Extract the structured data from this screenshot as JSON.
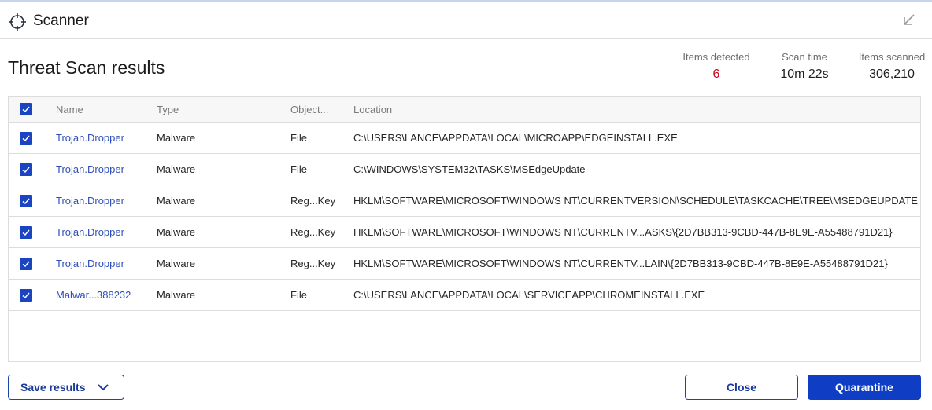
{
  "window": {
    "title": "Scanner",
    "app_icon": "crosshair-icon",
    "minimize_icon": "arrow-down-left-icon"
  },
  "page": {
    "heading": "Threat Scan results"
  },
  "stats": {
    "items_detected_label": "Items detected",
    "items_detected_value": "6",
    "scan_time_label": "Scan time",
    "scan_time_value": "10m 22s",
    "items_scanned_label": "Items scanned",
    "items_scanned_value": "306,210",
    "detected_color": "#d0021b"
  },
  "table": {
    "select_all_checked": true,
    "columns": {
      "name": "Name",
      "type": "Type",
      "object": "Object...",
      "location": "Location"
    },
    "rows": [
      {
        "checked": true,
        "name": "Trojan.Dropper",
        "type": "Malware",
        "object": "File",
        "location": "C:\\USERS\\LANCE\\APPDATA\\LOCAL\\MICROAPP\\EDGEINSTALL.EXE"
      },
      {
        "checked": true,
        "name": "Trojan.Dropper",
        "type": "Malware",
        "object": "File",
        "location": "C:\\WINDOWS\\SYSTEM32\\TASKS\\MSEdgeUpdate"
      },
      {
        "checked": true,
        "name": "Trojan.Dropper",
        "type": "Malware",
        "object": "Reg...Key",
        "location": "HKLM\\SOFTWARE\\MICROSOFT\\WINDOWS NT\\CURRENTVERSION\\SCHEDULE\\TASKCACHE\\TREE\\MSEDGEUPDATE"
      },
      {
        "checked": true,
        "name": "Trojan.Dropper",
        "type": "Malware",
        "object": "Reg...Key",
        "location": "HKLM\\SOFTWARE\\MICROSOFT\\WINDOWS NT\\CURRENTV...ASKS\\{2D7BB313-9CBD-447B-8E9E-A55488791D21}"
      },
      {
        "checked": true,
        "name": "Trojan.Dropper",
        "type": "Malware",
        "object": "Reg...Key",
        "location": "HKLM\\SOFTWARE\\MICROSOFT\\WINDOWS NT\\CURRENTV...LAIN\\{2D7BB313-9CBD-447B-8E9E-A55488791D21}"
      },
      {
        "checked": true,
        "name": "Malwar...388232",
        "type": "Malware",
        "object": "File",
        "location": "C:\\USERS\\LANCE\\APPDATA\\LOCAL\\SERVICEAPP\\CHROMEINSTALL.EXE"
      }
    ]
  },
  "footer": {
    "save_results_label": "Save results",
    "close_label": "Close",
    "quarantine_label": "Quarantine"
  },
  "colors": {
    "accent": "#0f3ec4",
    "link": "#2e4fb8"
  }
}
